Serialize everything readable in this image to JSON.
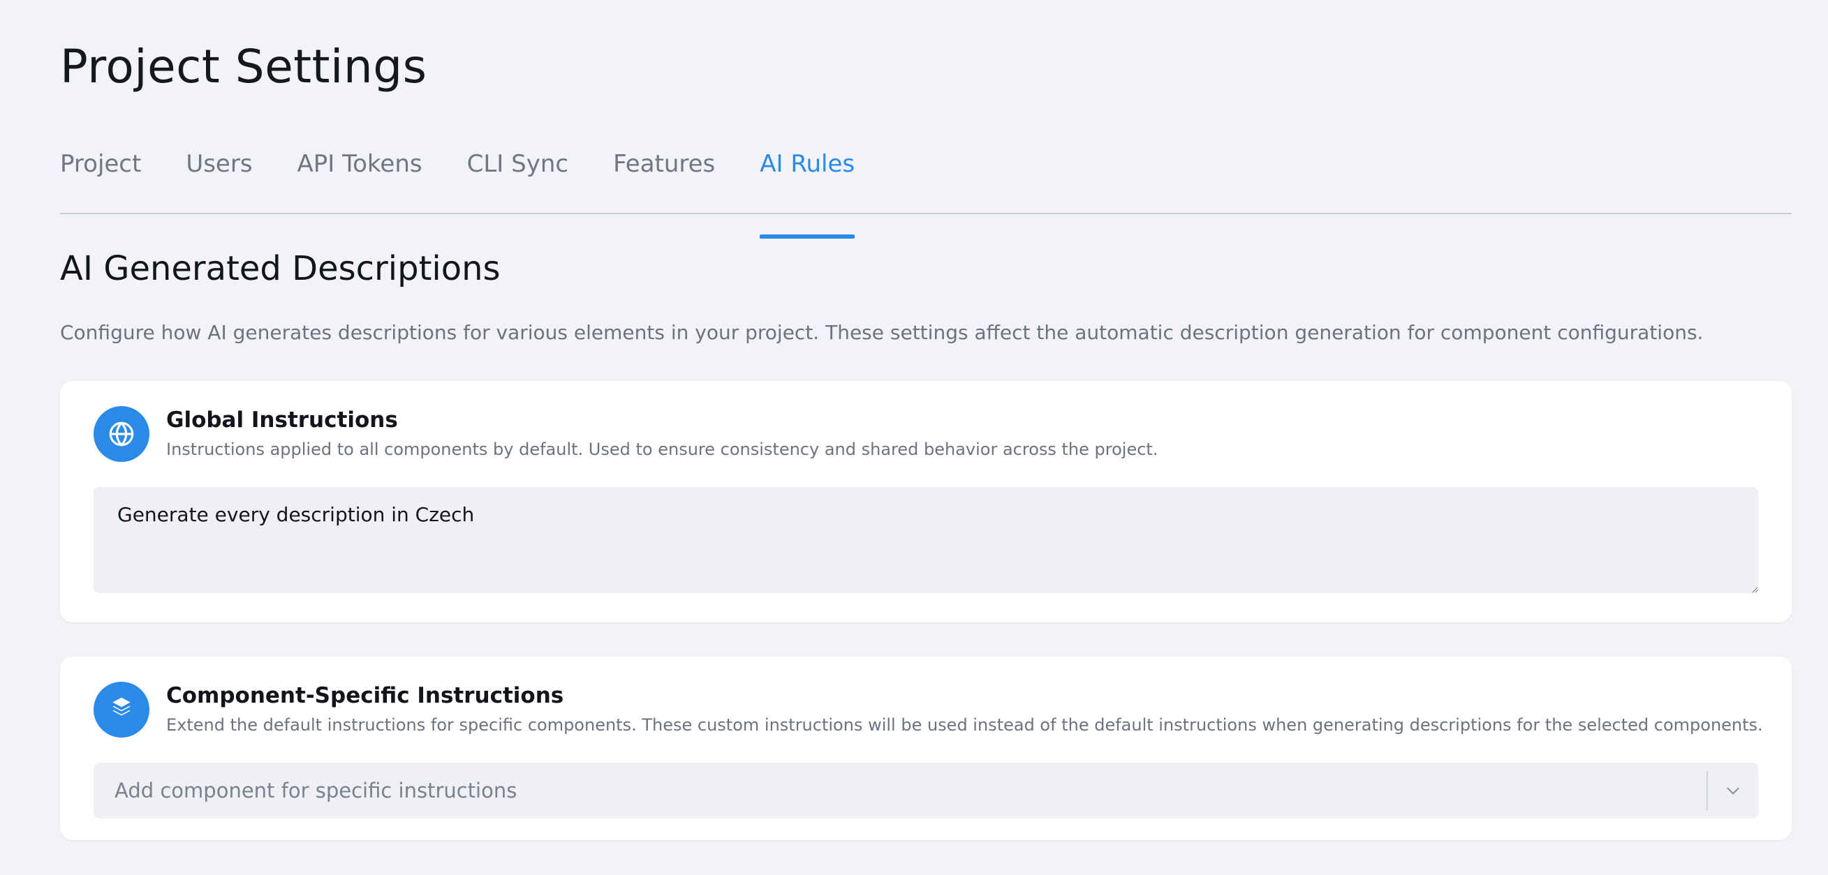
{
  "page": {
    "title": "Project Settings"
  },
  "tabs": [
    {
      "label": "Project",
      "active": false
    },
    {
      "label": "Users",
      "active": false
    },
    {
      "label": "API Tokens",
      "active": false
    },
    {
      "label": "CLI Sync",
      "active": false
    },
    {
      "label": "Features",
      "active": false
    },
    {
      "label": "AI Rules",
      "active": true
    }
  ],
  "section": {
    "title": "AI Generated Descriptions",
    "description": "Configure how AI generates descriptions for various elements in your project. These settings affect the automatic description generation for component configurations."
  },
  "global_instructions": {
    "icon": "globe-icon",
    "title": "Global Instructions",
    "subtitle": "Instructions applied to all components by default. Used to ensure consistency and shared behavior across the project.",
    "value": "Generate every description in Czech"
  },
  "component_instructions": {
    "icon": "layers-icon",
    "title": "Component-Specific Instructions",
    "subtitle": "Extend the default instructions for specific components. These custom instructions will be used instead of the default instructions when generating descriptions for the selected components.",
    "select_placeholder": "Add component for specific instructions"
  },
  "colors": {
    "accent": "#2a8ae8",
    "background": "#f2f3f7",
    "card": "#ffffff",
    "muted_text": "#6b7280",
    "input_bg": "#eff0f3"
  }
}
